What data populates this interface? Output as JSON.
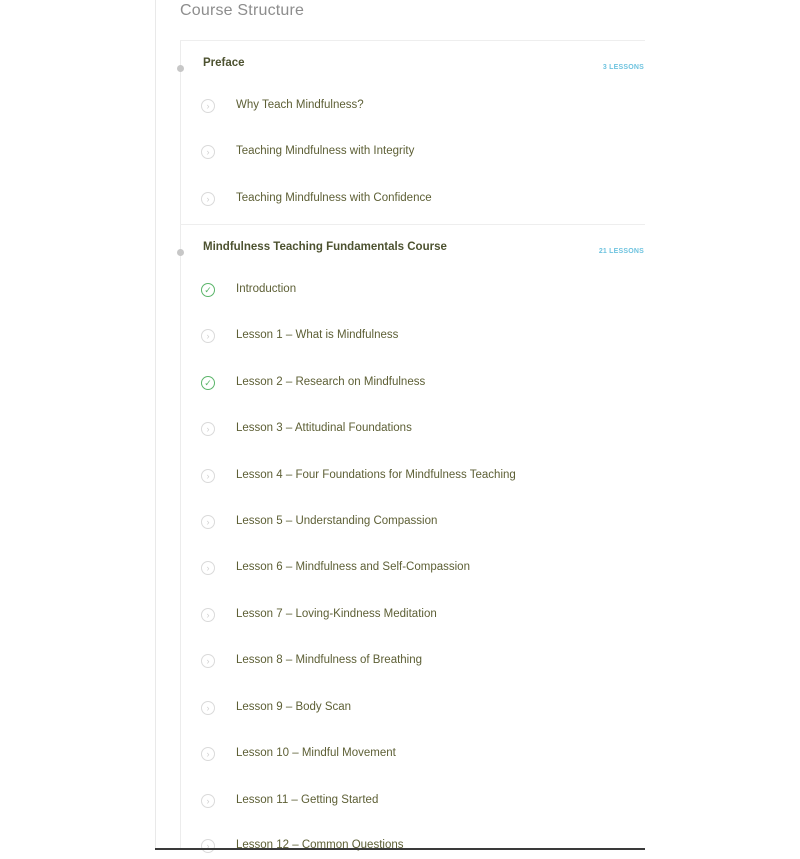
{
  "course_structure": {
    "title": "Course Structure",
    "sections": [
      {
        "title": "Preface",
        "lesson_count": "3 LESSONS",
        "lessons": [
          {
            "label": "Why Teach Mindfulness?",
            "status": "not-complete",
            "icon": "chevron-circle-icon"
          },
          {
            "label": "Teaching Mindfulness with Integrity",
            "status": "not-complete",
            "icon": "chevron-circle-icon"
          },
          {
            "label": "Teaching Mindfulness with Confidence",
            "status": "not-complete",
            "icon": "chevron-circle-icon"
          }
        ]
      },
      {
        "title": "Mindfulness Teaching Fundamentals Course",
        "lesson_count": "21 LESSONS",
        "lessons": [
          {
            "label": "Introduction",
            "status": "complete",
            "icon": "check-circle-icon"
          },
          {
            "label": "Lesson 1 – What is Mindfulness",
            "status": "not-complete",
            "icon": "chevron-circle-icon"
          },
          {
            "label": "Lesson 2 – Research on Mindfulness",
            "status": "complete",
            "icon": "check-circle-icon"
          },
          {
            "label": "Lesson 3 – Attitudinal Foundations",
            "status": "not-complete",
            "icon": "chevron-circle-icon"
          },
          {
            "label": "Lesson 4 – Four Foundations for Mindfulness Teaching",
            "status": "not-complete",
            "icon": "chevron-circle-icon"
          },
          {
            "label": "Lesson 5 – Understanding Compassion",
            "status": "not-complete",
            "icon": "chevron-circle-icon"
          },
          {
            "label": "Lesson 6 – Mindfulness and Self-Compassion",
            "status": "not-complete",
            "icon": "chevron-circle-icon"
          },
          {
            "label": "Lesson 7 – Loving-Kindness Meditation",
            "status": "not-complete",
            "icon": "chevron-circle-icon"
          },
          {
            "label": "Lesson 8 – Mindfulness of Breathing",
            "status": "not-complete",
            "icon": "chevron-circle-icon"
          },
          {
            "label": "Lesson 9 – Body Scan",
            "status": "not-complete",
            "icon": "chevron-circle-icon"
          },
          {
            "label": "Lesson 10 – Mindful Movement",
            "status": "not-complete",
            "icon": "chevron-circle-icon"
          },
          {
            "label": "Lesson 11 – Getting Started",
            "status": "not-complete",
            "icon": "chevron-circle-icon"
          },
          {
            "label": "Lesson 12 – Common Questions",
            "status": "not-complete",
            "icon": "chevron-circle-icon"
          }
        ]
      }
    ]
  },
  "colors": {
    "accent_blue": "#6ec3df",
    "complete_green": "#5bb56a",
    "text_olive": "#5d5f35"
  }
}
